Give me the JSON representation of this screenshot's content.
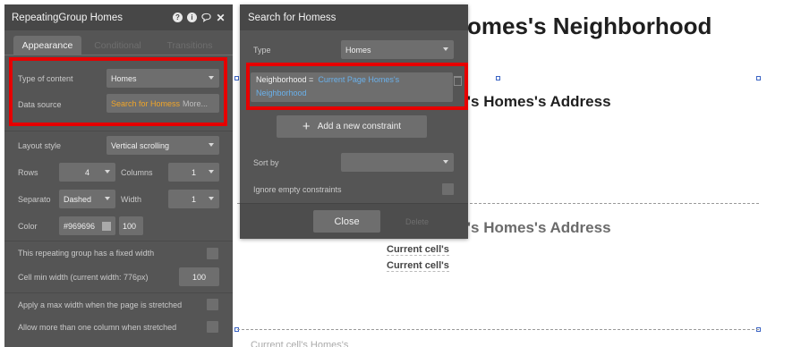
{
  "canvas": {
    "title": "omes's Neighborhood",
    "address_1": "'s Homes's Address",
    "address_2": "'s Homes's Address",
    "cell_text_1": "Current cell's",
    "cell_text_2": "Current cell's",
    "cell_bottom": "Current cell's Homes's"
  },
  "property_editor": {
    "title": "RepeatingGroup Homes",
    "icons": [
      "help-icon",
      "info-icon",
      "comment-icon",
      "close-icon"
    ],
    "tabs": [
      "Appearance",
      "Conditional",
      "Transitions"
    ],
    "active_tab": "Appearance",
    "type_of_content_label": "Type of content",
    "type_of_content_value": "Homes",
    "data_source_label": "Data source",
    "data_source_value": "Search for Homess",
    "data_source_more": "More...",
    "layout_style_label": "Layout style",
    "layout_style_value": "Vertical scrolling",
    "rows_label": "Rows",
    "rows_value": "4",
    "columns_label": "Columns",
    "columns_value": "1",
    "separator_label": "Separato",
    "separator_value": "Dashed",
    "width_label": "Width",
    "width_value": "1",
    "color_label": "Color",
    "color_value": "#969696",
    "opacity_value": "100",
    "fixed_width_label": "This repeating group has a fixed width",
    "cell_min_width_label": "Cell min width (current width: 776px)",
    "cell_min_width_value": "100",
    "max_width_label": "Apply a max width when the page is stretched",
    "more_columns_label": "Allow more than one column when stretched"
  },
  "search_popup": {
    "title": "Search for Homess",
    "type_label": "Type",
    "type_value": "Homes",
    "constraint_field": "Neighborhood =",
    "constraint_value": "Current Page Homes's Neighborhood",
    "add_constraint_label": "Add a new constraint",
    "sort_by_label": "Sort by",
    "sort_by_value": "",
    "ignore_empty_label": "Ignore empty constraints",
    "close_label": "Close",
    "delete_label": "Delete"
  },
  "colors": {
    "panel_bg": "#555555",
    "panel_header": "#474747",
    "field_bg": "#6e6e6e",
    "highlight_red": "#e60000",
    "dynamic_orange": "#f0a529",
    "dynamic_blue": "#6ab0ea"
  }
}
